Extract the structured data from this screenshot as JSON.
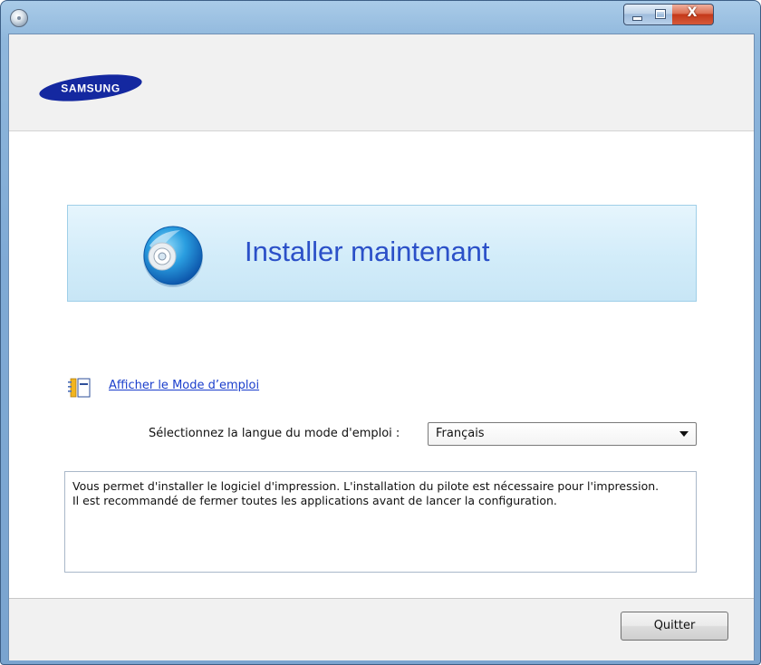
{
  "window": {
    "close_glyph": "X"
  },
  "header": {
    "brand": "SAMSUNG"
  },
  "main": {
    "install_label": "Installer maintenant",
    "manual_link": "Afficher le Mode d’emploi",
    "language_label": "Sélectionnez la langue du mode d'emploi :",
    "language_selected": "Français",
    "description_lines": [
      "Vous permet d'installer le logiciel d'impression. L'installation du pilote est nécessaire pour l'impression.",
      "Il est recommandé de fermer toutes les applications avant de lancer la configuration."
    ]
  },
  "footer": {
    "quit_label": "Quitter"
  },
  "colors": {
    "brand_blue": "#1428a0",
    "link_blue": "#1a3ecc",
    "install_text": "#2b50c8",
    "banner_bg": "#d2ecf9"
  }
}
